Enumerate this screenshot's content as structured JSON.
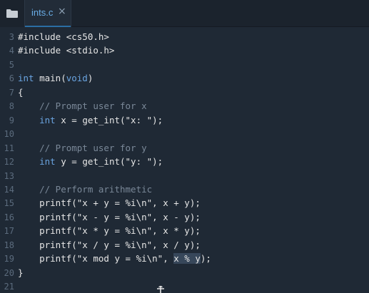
{
  "tab": {
    "filename": "ints.c",
    "close_glyph": "×"
  },
  "icons": {
    "folder": "folder-icon",
    "close": "close-icon",
    "cursor": "mouse-cursor-icon"
  },
  "colors": {
    "background": "#1f2935",
    "keyword": "#6aa4e0",
    "comment": "#7a8898",
    "line_number": "#5b6b7d",
    "tab_accent": "#6aaee8"
  },
  "lines": [
    {
      "n": "3",
      "segs": [
        [
          "",
          "#include <cs50.h>"
        ]
      ]
    },
    {
      "n": "4",
      "segs": [
        [
          "",
          "#include <stdio.h>"
        ]
      ]
    },
    {
      "n": "5",
      "segs": []
    },
    {
      "n": "6",
      "segs": [
        [
          "kw",
          "int"
        ],
        [
          "",
          " main("
        ],
        [
          "kw",
          "void"
        ],
        [
          "",
          ")"
        ]
      ]
    },
    {
      "n": "7",
      "segs": [
        [
          "",
          "{"
        ]
      ]
    },
    {
      "n": "8",
      "segs": [
        [
          "com",
          "    // Prompt user for x"
        ]
      ]
    },
    {
      "n": "9",
      "segs": [
        [
          "",
          "    "
        ],
        [
          "kw",
          "int"
        ],
        [
          "",
          " x = get_int(\"x: \");"
        ]
      ]
    },
    {
      "n": "10",
      "segs": []
    },
    {
      "n": "11",
      "segs": [
        [
          "com",
          "    // Prompt user for y"
        ]
      ]
    },
    {
      "n": "12",
      "segs": [
        [
          "",
          "    "
        ],
        [
          "kw",
          "int"
        ],
        [
          "",
          " y = get_int(\"y: \");"
        ]
      ]
    },
    {
      "n": "13",
      "segs": []
    },
    {
      "n": "14",
      "segs": [
        [
          "com",
          "    // Perform arithmetic"
        ]
      ]
    },
    {
      "n": "15",
      "segs": [
        [
          "",
          "    printf(\"x + y = %i\\n\", x + y);"
        ]
      ]
    },
    {
      "n": "16",
      "segs": [
        [
          "",
          "    printf(\"x - y = %i\\n\", x - y);"
        ]
      ]
    },
    {
      "n": "17",
      "segs": [
        [
          "",
          "    printf(\"x * y = %i\\n\", x * y);"
        ]
      ]
    },
    {
      "n": "18",
      "segs": [
        [
          "",
          "    printf(\"x / y = %i\\n\", x / y);"
        ]
      ]
    },
    {
      "n": "19",
      "segs": [
        [
          "",
          "    printf(\"x mod y = %i\\n\", "
        ],
        [
          "sel",
          "x % y"
        ],
        [
          "",
          ");"
        ]
      ]
    },
    {
      "n": "20",
      "segs": [
        [
          "",
          "}"
        ]
      ]
    },
    {
      "n": "21",
      "segs": []
    }
  ]
}
